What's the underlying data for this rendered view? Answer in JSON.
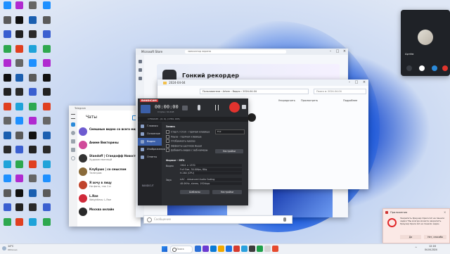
{
  "desktop": {
    "icons": [
      {
        "label": "",
        "color": "#1e90ff"
      },
      {
        "label": "",
        "color": "#5a5a5a"
      },
      {
        "label": "",
        "color": "#3a5fd0"
      },
      {
        "label": "",
        "color": "#2ea84f"
      },
      {
        "label": "",
        "color": "#b02ad0"
      },
      {
        "label": "",
        "color": "#111111"
      },
      {
        "label": "",
        "color": "#222222"
      },
      {
        "label": "",
        "color": "#e04020"
      },
      {
        "label": "",
        "color": "#666666"
      },
      {
        "label": "",
        "color": "#1b5fb0"
      },
      {
        "label": "",
        "color": "#2a2a2a"
      },
      {
        "label": "",
        "color": "#1fa3d9"
      }
    ]
  },
  "telegram": {
    "title": "Чаты",
    "chats": [
      {
        "name": "Смешные видео со всего мира",
        "preview": "",
        "avatar": "#6d5bd0"
      },
      {
        "name": "Аниме Викторины",
        "preview": "",
        "avatar": "#d04a9a"
      },
      {
        "name": "Standoff | Стандофф Новости",
        "preview": "Художественный",
        "avatar": "#333333"
      },
      {
        "name": "Клубушк | со смыслом",
        "preview": "Телеграм",
        "avatar": "#8a6b3a"
      },
      {
        "name": "Я хочу в лицу",
        "preview": "Ни фото, так 1 и",
        "avatar": "#c0442c"
      },
      {
        "name": "L.Rae",
        "preview": "Weightless: L.Rae",
        "avatar": "#d02a3a"
      },
      {
        "name": "Москва онлайн",
        "preview": "",
        "avatar": "#2a2a2a"
      }
    ],
    "message_placeholder": "Сообщение"
  },
  "browser": {
    "title": "Microsoft Store",
    "tab": "записатор экрана",
    "heading": "Гонкий рекордер"
  },
  "explorer": {
    "title": "2024-04-04",
    "breadcrumb": "Пользователи › Artem › Видео › 2024-04-04",
    "search_placeholder": "Поиск в: 2024-04-04",
    "sort_label": "Упорядочить",
    "view_label": "Просмотреть",
    "details_label": "Подробнее"
  },
  "bandicam": {
    "logo": "BANDICAM",
    "timer": "00:00:00",
    "size": "0 bytes / 64.4GB",
    "resolution_info": "1784x945 - (0, 0), (1784, 945)",
    "menu": [
      {
        "label": "Главная"
      },
      {
        "label": "Основные"
      },
      {
        "label": "Видео"
      },
      {
        "label": "Изображения"
      },
      {
        "label": "Ответы"
      }
    ],
    "section_record": "Запись",
    "options": [
      "Старт / Стоп - горячая клавиша",
      "Пауза - горячая клавиша",
      "Отображать курсор",
      "Эффекты щелчков мыши",
      "Добавить видео с веб-камеры"
    ],
    "hotkey_value": "F12",
    "settings_button": "Настройки",
    "section_format": "Формат - MP4",
    "video_label": "Видео",
    "audio_label": "Звук",
    "video_lines": [
      "1904 × 1370",
      "Full Size, 30.00fps, 80q",
      "H.264 (CPU)"
    ],
    "audio_lines": [
      "AAC - Advanced Audio Coding",
      "48.0KHz, stereo, 192kbps"
    ],
    "templates_button": "Шаблоны",
    "format_settings_button": "Настройки",
    "version": "BANDICUT"
  },
  "video_call": {
    "user": "Артём"
  },
  "toast": {
    "app": "Приложения",
    "text": "Закрепить браузер Opera GX на панели задач? Вы всегда можете закрепить браузер Opera GX на панели задач.",
    "yes": "Да",
    "no": "Нет, спасибо"
  },
  "taskbar": {
    "weather": "14°C",
    "weather_desc": "Облачно",
    "search_placeholder": "Поиск",
    "time": "12:16",
    "date": "04.04.2024",
    "apps": [
      "#2b6fd6",
      "#6c3bd1",
      "#0a7ad6",
      "#f2a900",
      "#1a73e8",
      "#d63b2f",
      "#2aa1de",
      "#3c3c3c",
      "#1ea04a",
      "#d4d4d4",
      "#e64a2e"
    ]
  }
}
